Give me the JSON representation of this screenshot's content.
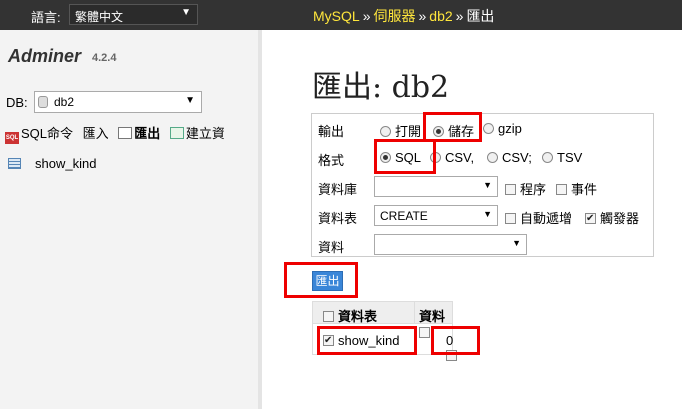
{
  "topbar": {
    "lang_label": "語言:",
    "lang_value": "繁體中文",
    "crumbs": [
      "MySQL",
      "伺服器",
      "db2"
    ],
    "separator": "»",
    "current": "匯出"
  },
  "sidebar": {
    "app_name": "Adminer",
    "version": "4.2.4",
    "db_label": "DB:",
    "db_value": "db2",
    "links": {
      "sql": "SQL命令",
      "import": "匯入",
      "export": "匯出",
      "create": "建立資"
    },
    "tables": [
      "show_kind"
    ]
  },
  "main": {
    "title": "匯出: db2",
    "options": {
      "output_label": "輸出",
      "output_opts": [
        "打開",
        "儲存",
        "gzip"
      ],
      "output_selected": "儲存",
      "format_label": "格式",
      "format_opts": [
        "SQL",
        "CSV,",
        "CSV;",
        "TSV"
      ],
      "format_selected": "SQL",
      "db_label": "資料庫",
      "db_value": "",
      "routines_label": "程序",
      "events_label": "事件",
      "tables_label": "資料表",
      "tables_value": "CREATE",
      "autoinc_label": "自動遞增",
      "triggers_label": "觸發器",
      "data_label": "資料",
      "data_value": ""
    },
    "export_button": "匯出",
    "table": {
      "col_table": "資料表",
      "col_data": "資料",
      "rows": [
        {
          "name": "show_kind",
          "count": "0"
        }
      ]
    }
  },
  "colors": {
    "topbar": "#333333",
    "crumb_link": "#ffe63c",
    "button": "#3a86d8",
    "highlight": "#e00000"
  },
  "icons": [
    "chevron-down-icon",
    "database-icon",
    "sql-icon",
    "import-icon",
    "export-icon",
    "create-table-icon",
    "table-icon"
  ]
}
